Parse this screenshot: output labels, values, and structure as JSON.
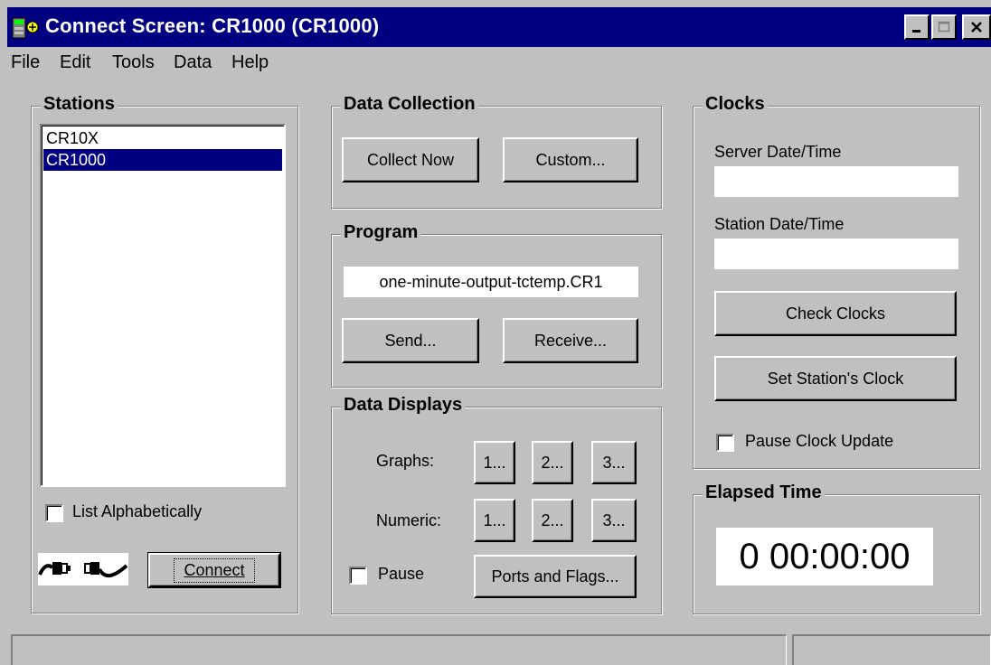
{
  "window": {
    "title": "Connect Screen: CR1000 (CR1000)"
  },
  "menu": [
    "File",
    "Edit",
    "Tools",
    "Data",
    "Help"
  ],
  "stations": {
    "label": "Stations",
    "items": [
      "CR10X",
      "CR1000"
    ],
    "selected_index": 1,
    "list_alphabetically_label": "List Alphabetically",
    "connect_label": "Connect",
    "connection_icon": "disconnected-plug-icon"
  },
  "data_collection": {
    "label": "Data Collection",
    "collect_now_label": "Collect Now",
    "custom_label": "Custom..."
  },
  "program": {
    "label": "Program",
    "filename": "one-minute-output-tctemp.CR1",
    "send_label": "Send...",
    "receive_label": "Receive..."
  },
  "data_displays": {
    "label": "Data Displays",
    "graphs_label": "Graphs:",
    "numeric_label": "Numeric:",
    "graph_buttons": [
      "1...",
      "2...",
      "3..."
    ],
    "numeric_buttons": [
      "1...",
      "2...",
      "3..."
    ],
    "pause_label": "Pause",
    "ports_flags_label": "Ports and Flags..."
  },
  "clocks": {
    "label": "Clocks",
    "server_label": "Server Date/Time",
    "server_value": "",
    "station_label": "Station Date/Time",
    "station_value": "",
    "check_clocks_label": "Check Clocks",
    "set_clock_label": "Set Station's Clock",
    "pause_update_label": "Pause Clock Update"
  },
  "elapsed": {
    "label": "Elapsed Time",
    "value": "0 00:00:00"
  },
  "colors": {
    "titlebar": "#000080",
    "face": "#c0c0c0",
    "selection": "#000080"
  }
}
